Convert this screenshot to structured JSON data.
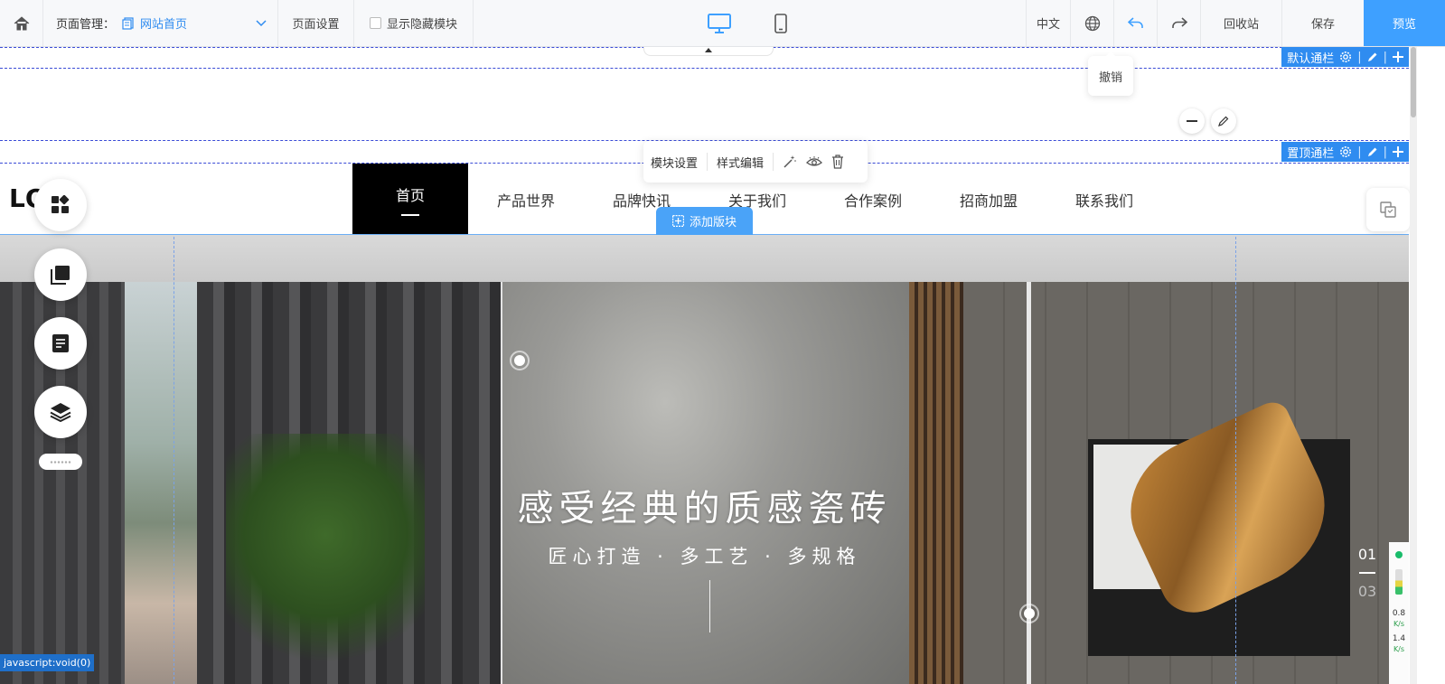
{
  "topbar": {
    "page_manage_label": "页面管理：",
    "current_page": "网站首页",
    "page_settings": "页面设置",
    "show_hidden": "显示隐藏模块",
    "language": "中文",
    "recycle_bin": "回收站",
    "save": "保存",
    "preview": "预览",
    "undo_tooltip": "撤销"
  },
  "sections": {
    "default_bar": "默认通栏",
    "pinned_bar": "置顶通栏"
  },
  "module_toolbar": {
    "module_settings": "模块设置",
    "style_edit": "样式编辑"
  },
  "header": {
    "logo": "LO",
    "nav": [
      {
        "label": "首页",
        "active": true
      },
      {
        "label": "产品世界"
      },
      {
        "label": "品牌快讯"
      },
      {
        "label": "关于我们"
      },
      {
        "label": "合作案例"
      },
      {
        "label": "招商加盟"
      },
      {
        "label": "联系我们"
      }
    ],
    "add_block": "添加版块"
  },
  "hero": {
    "title": "感受经典的质感瓷砖",
    "subtitle": "匠心打造 · 多工艺 · 多规格",
    "page_current": "01",
    "page_total": "03"
  },
  "status_widget": {
    "upload": "0.8",
    "upload_unit": "K/s",
    "download": "1.4",
    "download_unit": "K/s"
  },
  "status_url": "javascript:void(0)",
  "colors": {
    "accent": "#2f8cf0",
    "preview_bg": "#3ea0ff",
    "nav_active_bg": "#000000",
    "guide_line": "#3a4bd6"
  }
}
